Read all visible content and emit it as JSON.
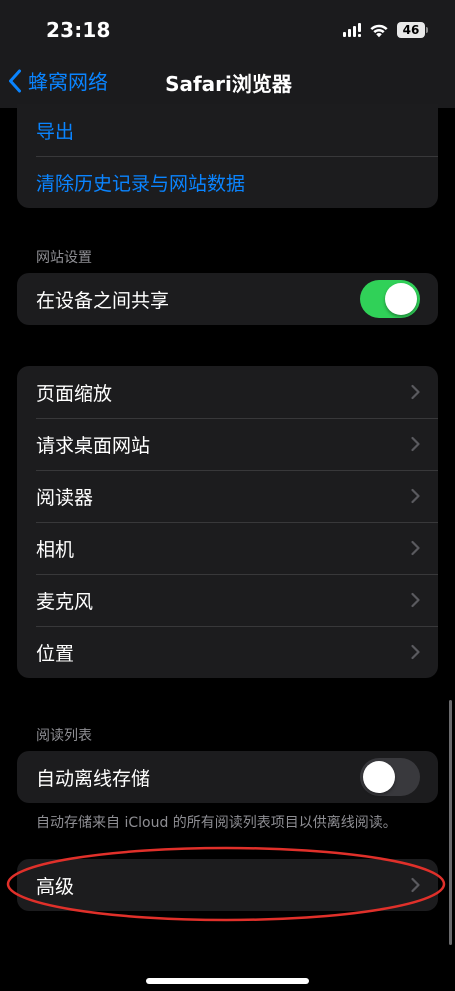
{
  "status_bar": {
    "time": "23:18",
    "battery": "46",
    "icons": [
      "signal-icon",
      "wifi-icon",
      "battery-icon"
    ]
  },
  "nav": {
    "back_label": "蜂窝网络",
    "title": "Safari浏览器"
  },
  "privacy_group": {
    "items": [
      {
        "label": "导出"
      },
      {
        "label": "清除历史记录与网站数据"
      }
    ]
  },
  "website_settings": {
    "header": "网站设置",
    "share_label": "在设备之间共享",
    "share_enabled": true
  },
  "site_options": {
    "items": [
      {
        "label": "页面缩放"
      },
      {
        "label": "请求桌面网站"
      },
      {
        "label": "阅读器"
      },
      {
        "label": "相机"
      },
      {
        "label": "麦克风"
      },
      {
        "label": "位置"
      }
    ]
  },
  "reading_list": {
    "header": "阅读列表",
    "offline_label": "自动离线存储",
    "offline_enabled": false,
    "footer": "自动存储来自 iCloud 的所有阅读列表项目以供离线阅读。"
  },
  "advanced": {
    "label": "高级"
  },
  "colors": {
    "accent": "#0a84ff",
    "toggle_on": "#30d158",
    "annotation": "#e0302a"
  }
}
